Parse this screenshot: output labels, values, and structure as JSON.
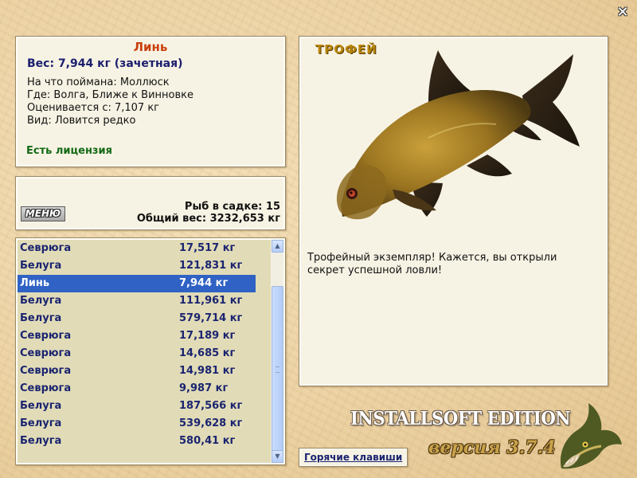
{
  "info": {
    "name": "Линь",
    "weight": "Вес: 7,944 кг (зачетная)",
    "lines": [
      "На что поймана: Моллюск",
      "Где: Волга, Ближе к Винновке",
      "Оценивается с: 7,107 кг",
      "Вид: Ловится редко"
    ],
    "license": "Есть лицензия"
  },
  "summary": {
    "menu_label": "МЕНЮ",
    "fish_count": "Рыб в садке: 15",
    "total_weight": "Общий вес: 3232,653 кг"
  },
  "catch_list": [
    {
      "name": "Севрюга",
      "weight": "17,517 кг"
    },
    {
      "name": "Белуга",
      "weight": "121,831 кг"
    },
    {
      "name": "Линь",
      "weight": "7,944 кг",
      "selected": true
    },
    {
      "name": "Белуга",
      "weight": "111,961 кг"
    },
    {
      "name": "Белуга",
      "weight": "579,714 кг"
    },
    {
      "name": "Севрюга",
      "weight": "17,189 кг"
    },
    {
      "name": "Севрюга",
      "weight": "14,685 кг"
    },
    {
      "name": "Севрюга",
      "weight": "14,981 кг"
    },
    {
      "name": "Севрюга",
      "weight": "9,987 кг"
    },
    {
      "name": "Белуга",
      "weight": "187,566 кг"
    },
    {
      "name": "Белуга",
      "weight": "539,628 кг"
    },
    {
      "name": "Белуга",
      "weight": "580,41 кг"
    }
  ],
  "trophy": {
    "title": "ТРОФЕЙ",
    "text": "Трофейный экземпляр! Кажется, вы открыли секрет успешной ловли!"
  },
  "branding": {
    "edition": "INSTALLSOFT EDITION",
    "version": "версия 3.7.4"
  },
  "hotkeys_label": "Горячие клавиши",
  "colors": {
    "accent_title": "#c8400e",
    "list_text": "#1b2470",
    "selection": "#2f62c4",
    "license": "#136a16",
    "trophy_title": "#b8860b"
  },
  "icons": {
    "close": "close-icon",
    "fish_picture": "tench-fish-image",
    "logo": "pike-logo"
  }
}
